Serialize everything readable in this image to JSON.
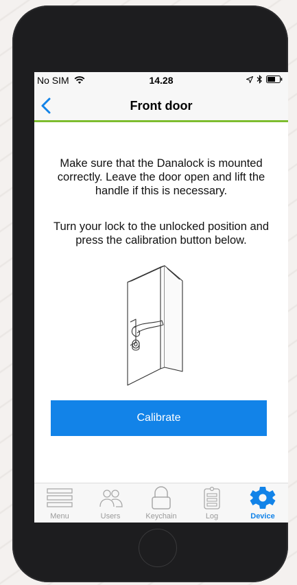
{
  "status_bar": {
    "carrier": "No SIM",
    "time": "14.28"
  },
  "nav": {
    "title": "Front door",
    "back_icon": "chevron-left-icon"
  },
  "content": {
    "instruction_1": "Make sure that the Danalock is mounted correctly. Leave the door open and lift the handle if this is necessary.",
    "instruction_2": "Turn your lock to the unlocked position and press the calibration button below.",
    "illustration": "door-handle-icon"
  },
  "calibrate_button_label": "Calibrate",
  "tabs": [
    {
      "label": "Menu",
      "icon": "menu-icon",
      "active": false
    },
    {
      "label": "Users",
      "icon": "users-icon",
      "active": false
    },
    {
      "label": "Keychain",
      "icon": "padlock-icon",
      "active": false
    },
    {
      "label": "Log",
      "icon": "clipboard-icon",
      "active": false
    },
    {
      "label": "Device",
      "icon": "gear-icon",
      "active": true
    }
  ],
  "colors": {
    "accent": "#1283e8",
    "nav_underline": "#7dbd2f"
  }
}
